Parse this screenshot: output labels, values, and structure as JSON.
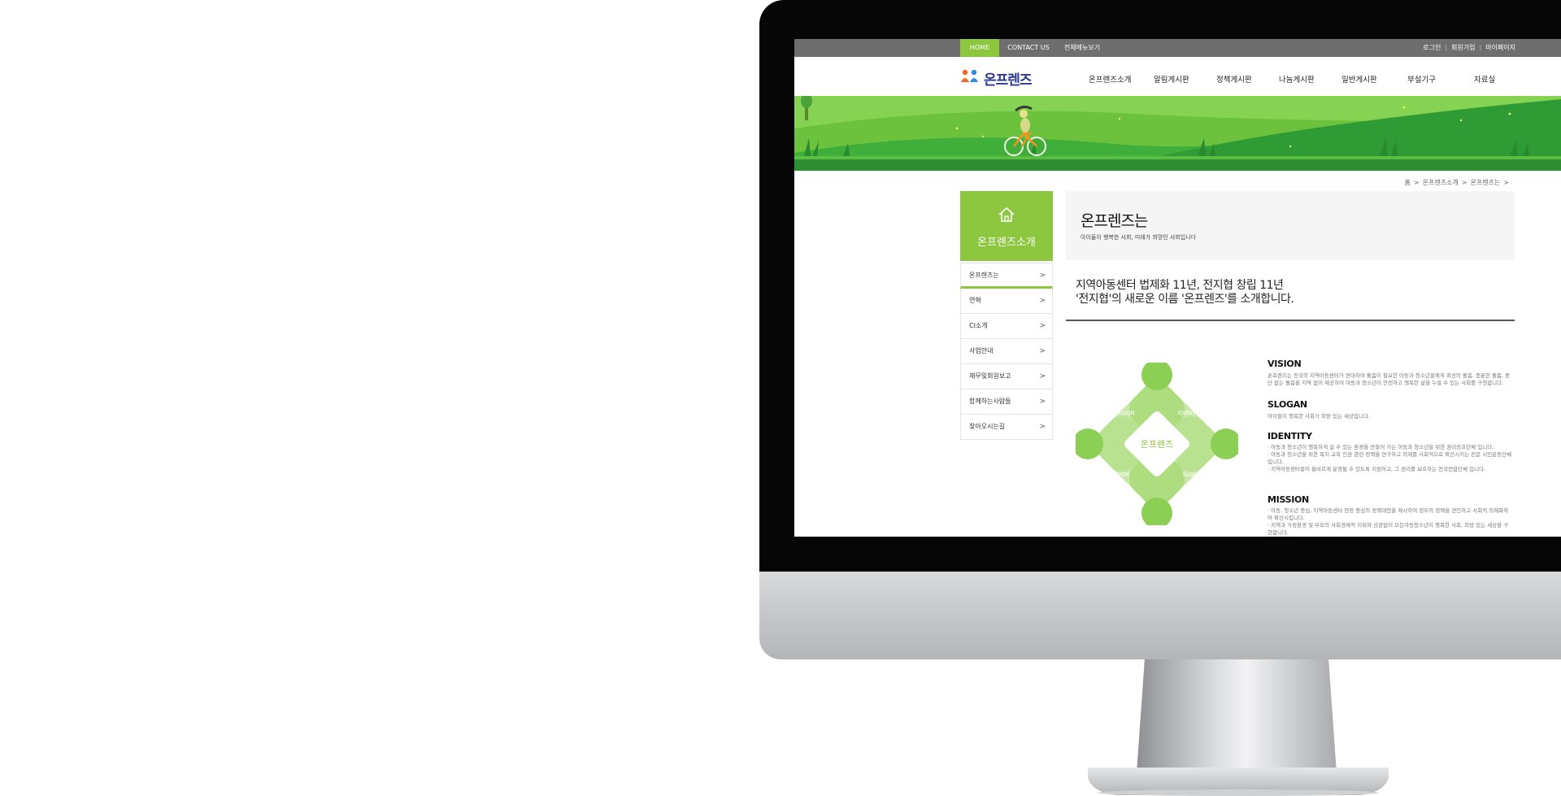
{
  "top_nav": {
    "home": "HOME",
    "contact": "CONTACT US",
    "sitemap": "전체메뉴보기",
    "login": "로그인",
    "join": "회원가입",
    "mypage": "마이페이지"
  },
  "brand": {
    "logo_text": "온프렌즈",
    "accent": "#8dc63f",
    "nav_dark": "#6e6e6e"
  },
  "gnb": [
    "온프렌즈소개",
    "알림게시판",
    "정책게시판",
    "나눔게시판",
    "일반게시판",
    "부설기구",
    "자료실"
  ],
  "breadcrumb": {
    "home": "홈",
    "level1": "온프렌즈소개",
    "level2": "온프렌즈는"
  },
  "lnb": {
    "title": "온프렌즈소개",
    "icon": "home-icon",
    "items": [
      "온프렌즈는",
      "연혁",
      "CI소개",
      "사업안내",
      "재무및회원보고",
      "함께하는사람들",
      "찾아오시는길"
    ],
    "active_index": 0
  },
  "content": {
    "title": "온프렌즈는",
    "subtitle": "아이들이 행복한 사회, 미래가 희망인 사회입니다",
    "lead_line1": "지역아동센터 법제화 11년, 전지협 창립 11년",
    "lead_line2": "'전지협'의 새로운 이름 '온프렌즈'를 소개합니다."
  },
  "diagram": {
    "center": "온프렌즈",
    "mission": "MISSION",
    "identity": "IDENTITY",
    "vision": "VISION",
    "slogan": "SLOGAN"
  },
  "sections": {
    "vision_title": "VISION",
    "vision_text": "온프렌즈는 전국의 지역아동센터가 연대하여 돌봄이 필요한 아동과 청소년들에게 최선의 돌봄, 충분한 돌봄, 중단 없는 돌봄을 지역 없이 제공하여 아동과 청소년이 안전하고 행복한 삶을 누릴 수 있는 사회를 구현합니다.",
    "slogan_title": "SLOGAN",
    "slogan_text": "아이들이 행복한 사회가 희망 있는 세상입니다.",
    "identity_title": "IDENTITY",
    "identity_1": "· 아동과 청소년이 행복하게 살 수 있는 환경을 만들어 가는 아동과 청소년을 위한 권리옹호단체 입니다.",
    "identity_2": "· 아동과 청소년을 위한 복지 교육 인권 관련 정책을 연구하고 의제를 사회적으로 확산시키는 전문 시민운동단체입니다.",
    "identity_3": "· 지역아동센터들이 올바르게 운영될 수 있도록 지원하고, 그 권리를 보호하는 전국연합단체 입니다.",
    "mission_title": "MISSION",
    "mission_1": "· 아동, 청소년 중심, 지역아동센터 현장 중심의 정책대안을 제시하여 정부의 정책을 견인하고 사회적 의제화하여 확산시킵니다.",
    "mission_2": "· 지역과 가정환경 및 부모의 사회경제적 지위와 상관없이 모든아동청소년이 행복한 사회, 희망 있는 세상을 구현합니다."
  }
}
